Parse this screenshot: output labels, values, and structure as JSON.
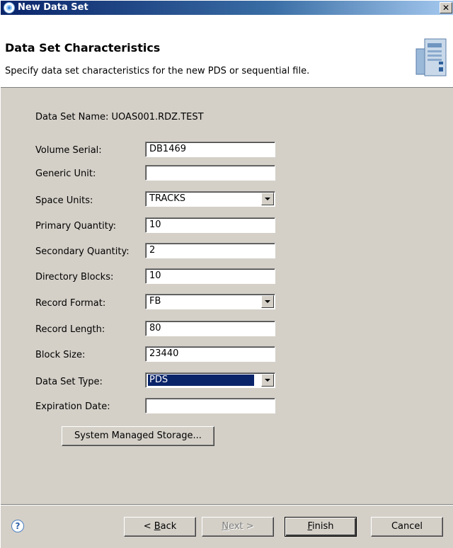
{
  "window": {
    "title": "New Data Set",
    "close_symbol": "✕"
  },
  "header": {
    "heading": "Data Set Characteristics",
    "description": "Specify data set characteristics for the new PDS or sequential file."
  },
  "form": {
    "data_set_name_label": "Data Set Name:",
    "data_set_name_value": "UOAS001.RDZ.TEST",
    "fields": [
      {
        "label": "Volume Serial:",
        "value": "DB1469"
      },
      {
        "label": "Generic Unit:",
        "value": ""
      },
      {
        "label": "Space Units:",
        "value": "TRACKS"
      },
      {
        "label": "Primary Quantity:",
        "value": "10"
      },
      {
        "label": "Secondary Quantity:",
        "value": "2"
      },
      {
        "label": "Directory Blocks:",
        "value": "10"
      },
      {
        "label": "Record Format:",
        "value": "FB"
      },
      {
        "label": "Record Length:",
        "value": "80"
      },
      {
        "label": "Block Size:",
        "value": "23440"
      },
      {
        "label": "Data Set Type:",
        "value": "PDS"
      },
      {
        "label": "Expiration Date:",
        "value": ""
      }
    ],
    "sms_button": "System Managed Storage..."
  },
  "footer": {
    "help_symbol": "?",
    "back": {
      "mnemonic": "B",
      "rest": "ack",
      "prefix": "< "
    },
    "next": {
      "mnemonic": "N",
      "rest": "ext >"
    },
    "finish": {
      "mnemonic": "F",
      "rest": "inish"
    },
    "cancel": "Cancel"
  },
  "colors": {
    "selection": "#0a246a",
    "dialog_bg": "#d4d0c8",
    "titlebar": "#0a246a"
  }
}
